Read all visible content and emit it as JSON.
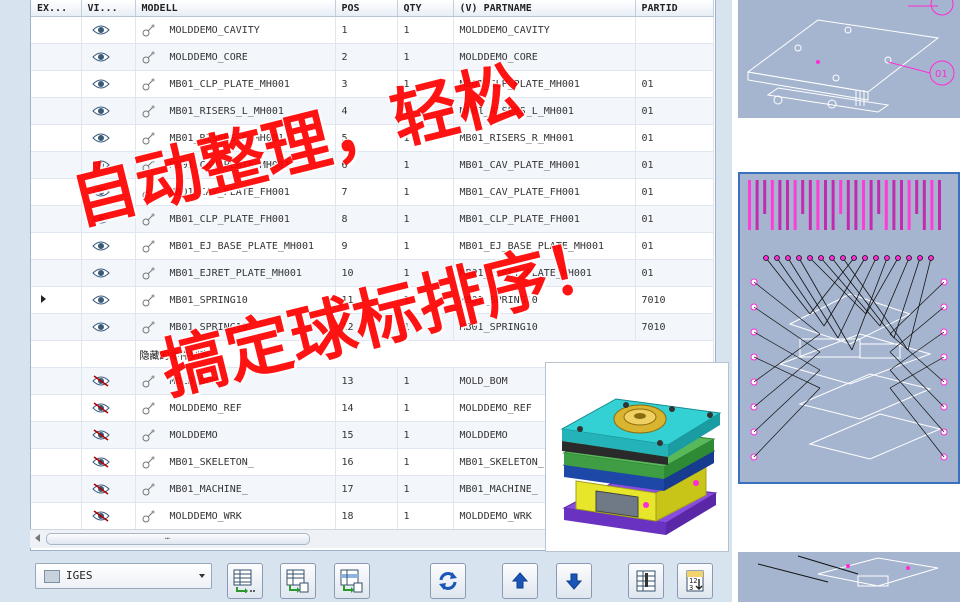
{
  "table": {
    "columns": [
      "EX...",
      "VI...",
      "MODELL",
      "POS",
      "QTY",
      "(V) PARTNAME",
      "PARTID"
    ],
    "rows": [
      {
        "visible": true,
        "model": "MOLDDEMO_CAVITY",
        "pos": "1",
        "qty": "1",
        "partname": "MOLDDEMO_CAVITY",
        "partid": ""
      },
      {
        "visible": true,
        "model": "MOLDDEMO_CORE",
        "pos": "2",
        "qty": "1",
        "partname": "MOLDDEMO_CORE",
        "partid": ""
      },
      {
        "visible": true,
        "model": "MB01_CLP_PLATE_MH001",
        "pos": "3",
        "qty": "1",
        "partname": "MB01_CLP_PLATE_MH001",
        "partid": "01"
      },
      {
        "visible": true,
        "model": "MB01_RISERS_L_MH001",
        "pos": "4",
        "qty": "1",
        "partname": "MB01_RISERS_L_MH001",
        "partid": "01"
      },
      {
        "visible": true,
        "model": "MB01_RISERS_R_MH001",
        "pos": "5",
        "qty": "1",
        "partname": "MB01_RISERS_R_MH001",
        "partid": "01"
      },
      {
        "visible": true,
        "model": "MB01_CAV_PLATE_MH001",
        "pos": "6",
        "qty": "1",
        "partname": "MB01_CAV_PLATE_MH001",
        "partid": "01"
      },
      {
        "visible": true,
        "model": "MB01_CAV_PLATE_FH001",
        "pos": "7",
        "qty": "1",
        "partname": "MB01_CAV_PLATE_FH001",
        "partid": "01"
      },
      {
        "visible": true,
        "model": "MB01_CLP_PLATE_FH001",
        "pos": "8",
        "qty": "1",
        "partname": "MB01_CLP_PLATE_FH001",
        "partid": "01"
      },
      {
        "visible": true,
        "model": "MB01_EJ_BASE_PLATE_MH001",
        "pos": "9",
        "qty": "1",
        "partname": "MB01_EJ_BASE_PLATE_MH001",
        "partid": "01"
      },
      {
        "visible": true,
        "model": "MB01_EJRET_PLATE_MH001",
        "pos": "10",
        "qty": "1",
        "partname": "MB01_EJRET_PLATE_MH001",
        "partid": "01"
      },
      {
        "visible": true,
        "model": "MB01_SPRING10",
        "pos": "11",
        "qty": "1",
        "partname": "MB01_SPRING10",
        "partid": "7010",
        "current": true
      },
      {
        "visible": true,
        "model": "MB01_SPRING10",
        "pos": "12",
        "qty": "1",
        "partname": "MB01_SPRING10",
        "partid": "7010"
      }
    ],
    "hidden_group_label": "隐藏的零件列表",
    "hidden_rows": [
      {
        "visible": false,
        "model": "MOLD_BOM",
        "pos": "13",
        "qty": "1",
        "partname": "MOLD_BOM",
        "partid": ""
      },
      {
        "visible": false,
        "model": "MOLDDEMO_REF",
        "pos": "14",
        "qty": "1",
        "partname": "MOLDDEMO_REF",
        "partid": ""
      },
      {
        "visible": false,
        "model": "MOLDDEMO",
        "pos": "15",
        "qty": "1",
        "partname": "MOLDDEMO",
        "partid": ""
      },
      {
        "visible": false,
        "model": "MB01_SKELETON_",
        "pos": "16",
        "qty": "1",
        "partname": "MB01_SKELETON_",
        "partid": ""
      },
      {
        "visible": false,
        "model": "MB01_MACHINE_",
        "pos": "17",
        "qty": "1",
        "partname": "MB01_MACHINE_",
        "partid": ""
      },
      {
        "visible": false,
        "model": "MOLDDEMO_WRK",
        "pos": "18",
        "qty": "1",
        "partname": "MOLDDEMO_WRK",
        "partid": ""
      }
    ]
  },
  "scrollbar": {
    "grip": "…"
  },
  "toolbar": {
    "format_select_value": "IGES",
    "buttons": [
      "export-list",
      "export-all",
      "export-selected",
      "refresh",
      "move-up",
      "move-down",
      "properties",
      "sort"
    ]
  },
  "watermark": {
    "line1": "自动整理，轻松",
    "line2": "搞定球标排序！"
  },
  "views": {
    "top_badge": "01"
  },
  "colors": {
    "accent_red": "#ff0000",
    "eye_icon": "#3a5a7a",
    "plate_cyan": "#31c4c8",
    "plate_blue": "#1b4fb0",
    "plate_green": "#4caf50",
    "plate_yellow": "#e4e02a",
    "plate_purple": "#7a3ccf",
    "balloon_magenta": "#ff2bd6"
  }
}
